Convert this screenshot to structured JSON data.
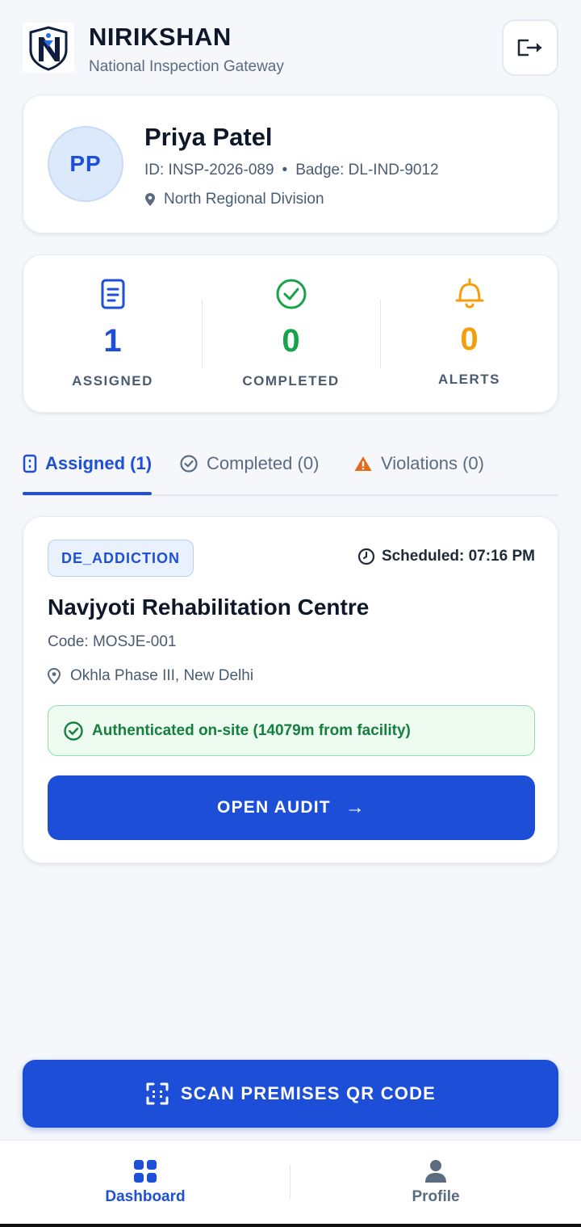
{
  "header": {
    "title": "NIRIKSHAN",
    "subtitle": "National Inspection Gateway",
    "logo_icon": "nirikshan-shield-logo",
    "logout_icon": "logout-icon"
  },
  "profile": {
    "initials": "PP",
    "name": "Priya Patel",
    "id_text": "ID: INSP-2026-089",
    "separator": "•",
    "badge_text": "Badge: DL-IND-9012",
    "location": "North Regional Division"
  },
  "stats": {
    "assigned": {
      "value": "1",
      "label": "ASSIGNED",
      "color": "#1e4fd8",
      "icon": "clipboard-icon"
    },
    "completed": {
      "value": "0",
      "label": "COMPLETED",
      "color": "#16a34a",
      "icon": "check-circle-icon"
    },
    "alerts": {
      "value": "0",
      "label": "ALERTS",
      "color": "#f59e0b",
      "icon": "bell-icon"
    }
  },
  "tabs": [
    {
      "label": "Assigned (1)",
      "icon": "clipboard-icon",
      "active": true
    },
    {
      "label": "Completed (0)",
      "icon": "check-circle-icon",
      "active": false
    },
    {
      "label": "Violations (0)",
      "icon": "warning-icon",
      "active": false
    }
  ],
  "inspection": {
    "category": "DE_ADDICTION",
    "scheduled": "Scheduled: 07:16 PM",
    "facility_name": "Navjyoti Rehabilitation Centre",
    "code": "Code: MOSJE-001",
    "location": "Okhla Phase III, New Delhi",
    "auth_status": "Authenticated on-site (14079m from facility)",
    "open_button": "OPEN AUDIT",
    "open_arrow": "→"
  },
  "scan_button": "SCAN PREMISES QR CODE",
  "nav": {
    "dashboard": "Dashboard",
    "profile": "Profile"
  },
  "colors": {
    "primary": "#1d4ed8",
    "success": "#16a34a",
    "warning": "#f59e0b",
    "background": "#f5f7fa"
  }
}
